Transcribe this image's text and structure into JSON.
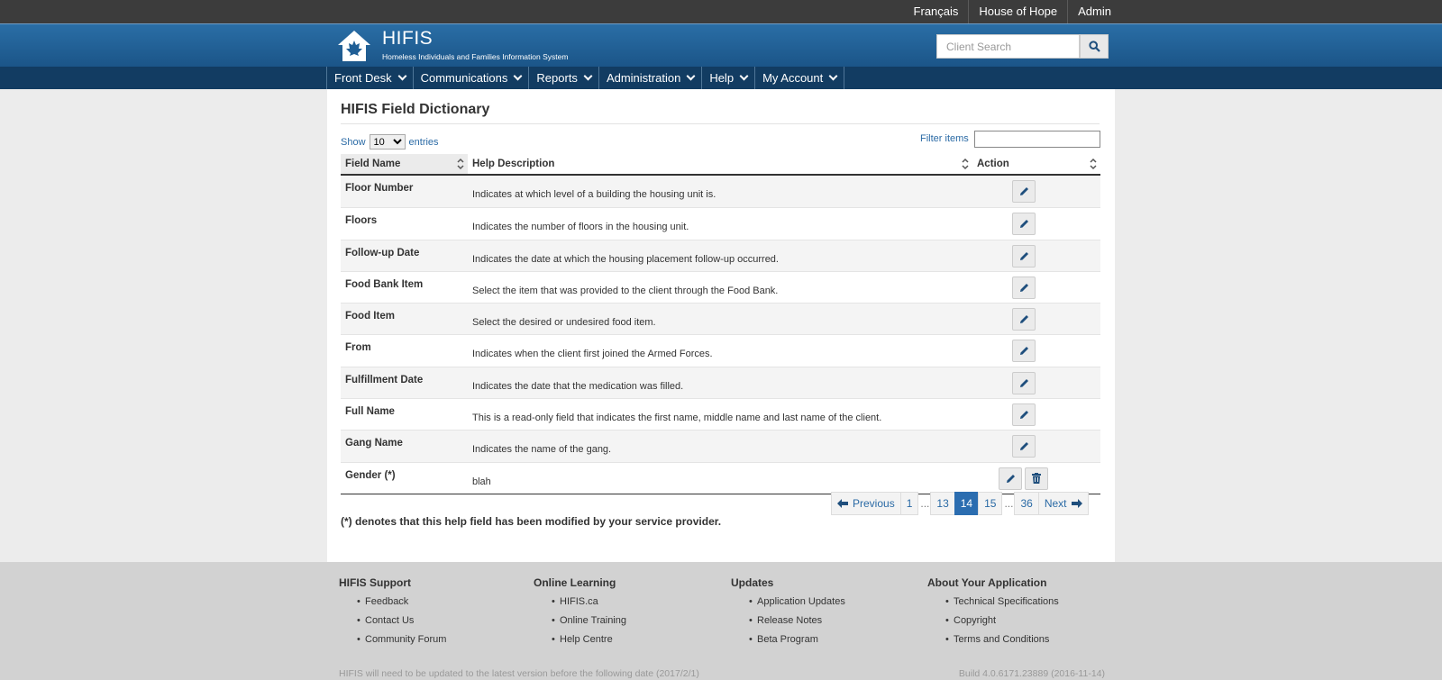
{
  "topbar": {
    "links": [
      "Français",
      "House of Hope",
      "Admin"
    ]
  },
  "header": {
    "title": "HIFIS",
    "subtitle": "Homeless Individuals and Families Information System",
    "search_placeholder": "Client Search"
  },
  "nav": [
    "Front Desk",
    "Communications",
    "Reports",
    "Administration",
    "Help",
    "My Account"
  ],
  "main": {
    "title": "HIFIS Field Dictionary",
    "show_label": "Show",
    "show_value": "10",
    "entries_label": "entries",
    "filter_label": "Filter items",
    "columns": [
      "Field Name",
      "Help Description",
      "Action"
    ],
    "rows": [
      {
        "field": "Floor Number",
        "help": "Indicates at which level of a building the housing unit is."
      },
      {
        "field": "Floors",
        "help": "Indicates the number of floors in the housing unit."
      },
      {
        "field": "Follow-up Date",
        "help": "Indicates the date at which the housing placement follow-up occurred."
      },
      {
        "field": "Food Bank Item",
        "help": "Select the item that was provided to the client through the Food Bank."
      },
      {
        "field": "Food Item",
        "help": "Select the desired or undesired food item."
      },
      {
        "field": "From",
        "help": "Indicates when the client first joined the Armed Forces."
      },
      {
        "field": "Fulfillment Date",
        "help": "Indicates the date that the medication was filled."
      },
      {
        "field": "Full Name",
        "help": "This is a read-only field that indicates the first name, middle name and last name of the client."
      },
      {
        "field": "Gang Name",
        "help": "Indicates the name of the gang."
      },
      {
        "field": "Gender (*)",
        "help": "blah",
        "deletable": true
      }
    ],
    "pagination": {
      "previous": "Previous",
      "next": "Next",
      "pages": [
        "1",
        "...",
        "13",
        "14",
        "15",
        "...",
        "36"
      ],
      "current": "14"
    },
    "note": "(*) denotes that this help field has been modified by your service provider."
  },
  "footer": {
    "columns": [
      {
        "title": "HIFIS Support",
        "items": [
          "Feedback",
          "Contact Us",
          "Community Forum"
        ]
      },
      {
        "title": "Online Learning",
        "items": [
          "HIFIS.ca",
          "Online Training",
          "Help Centre"
        ]
      },
      {
        "title": "Updates",
        "items": [
          "Application Updates",
          "Release Notes",
          "Beta Program"
        ]
      },
      {
        "title": "About Your Application",
        "items": [
          "Technical Specifications",
          "Copyright",
          "Terms and Conditions"
        ]
      }
    ],
    "update_notice": "HIFIS will need to be updated to the latest version before the following date (2017/2/1)",
    "build": "Build 4.0.6171.23889 (2016-11-14)"
  },
  "colors": {
    "accent": "#2b6db0",
    "header": "#1f5e95",
    "nav": "#123c62",
    "topbar": "#3c3c3c"
  }
}
